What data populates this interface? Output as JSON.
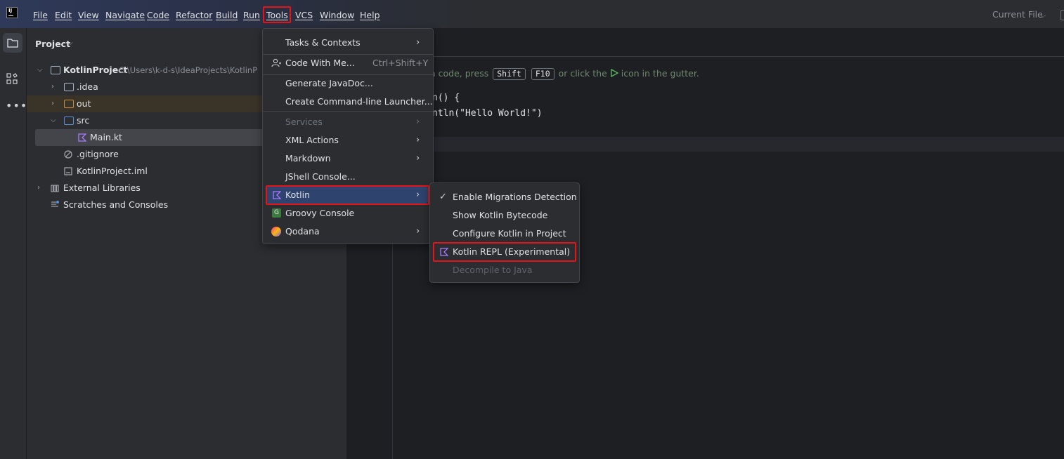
{
  "menubar": {
    "items": [
      "File",
      "Edit",
      "View",
      "Navigate",
      "Code",
      "Refactor",
      "Build",
      "Run",
      "Tools",
      "VCS",
      "Window",
      "Help"
    ],
    "current_file": "Current File"
  },
  "project_panel": {
    "title": "Project",
    "tree": [
      {
        "label": "KotlinProject",
        "path": "C:\\Users\\k-d-s\\IdeaProjects\\KotlinP",
        "icon": "module-folder-icon"
      },
      {
        "label": ".idea",
        "icon": "folder-icon"
      },
      {
        "label": "out",
        "icon": "excluded-folder-icon"
      },
      {
        "label": "src",
        "icon": "source-folder-icon"
      },
      {
        "label": "Main.kt",
        "icon": "kotlin-file-icon"
      },
      {
        "label": ".gitignore",
        "icon": "ignore-file-icon"
      },
      {
        "label": "KotlinProject.iml",
        "icon": "iml-file-icon"
      },
      {
        "label": "External Libraries",
        "icon": "libraries-icon"
      },
      {
        "label": "Scratches and Consoles",
        "icon": "scratches-icon"
      }
    ]
  },
  "editor": {
    "hint_prefix": "a code, press",
    "hint_key1": "Shift",
    "hint_key2": "F10",
    "hint_mid": "or click the",
    "hint_suffix": "icon in the gutter.",
    "code_line1": "n() {",
    "code_line2": "ntln(\"Hello World!\")"
  },
  "tools_menu": {
    "items": [
      {
        "label": "Tasks & Contexts",
        "submenu": true
      },
      {
        "label": "Code With Me...",
        "shortcut": "Ctrl+Shift+Y"
      },
      {
        "label": "Generate JavaDoc..."
      },
      {
        "label": "Create Command-line Launcher..."
      },
      {
        "label": "Services",
        "submenu": true,
        "disabled": true
      },
      {
        "label": "XML Actions",
        "submenu": true
      },
      {
        "label": "Markdown",
        "submenu": true
      },
      {
        "label": "JShell Console..."
      },
      {
        "label": "Kotlin",
        "submenu": true,
        "selected": true
      },
      {
        "label": "Groovy Console"
      },
      {
        "label": "Qodana",
        "submenu": true
      }
    ]
  },
  "kotlin_submenu": {
    "items": [
      {
        "label": "Enable Migrations Detection",
        "checked": true
      },
      {
        "label": "Show Kotlin Bytecode"
      },
      {
        "label": "Configure Kotlin in Project"
      },
      {
        "label": "Kotlin REPL (Experimental)",
        "icon": "kotlin-icon"
      },
      {
        "label": "Decompile to Java",
        "disabled": true
      }
    ]
  },
  "colors": {
    "highlight_border": "#e5141b",
    "selection": "#2e436e",
    "kotlin_purple": "#a97bff"
  }
}
